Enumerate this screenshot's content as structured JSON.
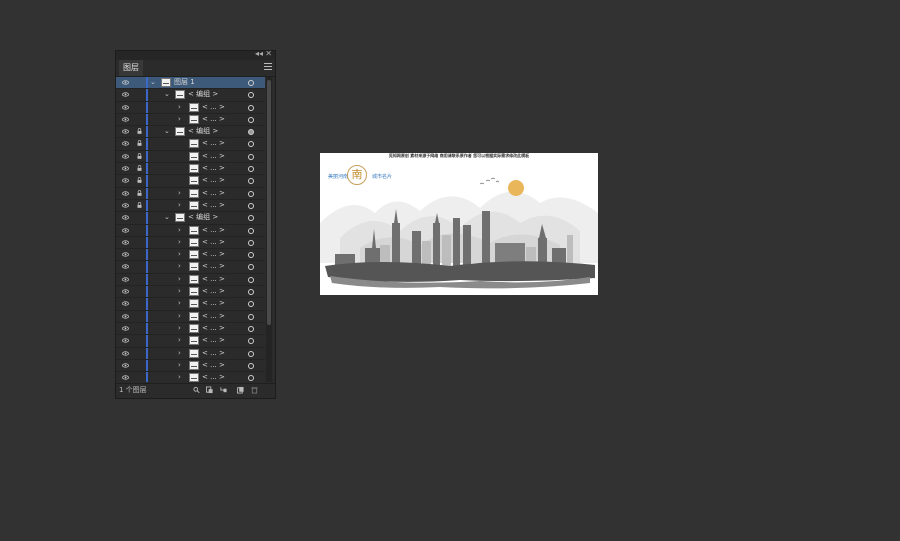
{
  "panel": {
    "tab_label": "图层",
    "collapse_glyph": "◂◂",
    "close_glyph": "✕",
    "layer_count": "1 个图层",
    "rows": [
      {
        "name": "图层 1",
        "indent": 0,
        "expanded": true,
        "locked": false,
        "selected": true,
        "target_filled": false
      },
      {
        "name": "< 编组 >",
        "indent": 1,
        "expanded": true,
        "locked": false,
        "selected": false,
        "target_filled": false
      },
      {
        "name": "< ... >",
        "indent": 2,
        "expanded": false,
        "locked": false,
        "selected": false,
        "target_filled": false
      },
      {
        "name": "< ... >",
        "indent": 2,
        "expanded": false,
        "locked": false,
        "selected": false,
        "target_filled": false
      },
      {
        "name": "< 编组 >",
        "indent": 1,
        "expanded": true,
        "locked": true,
        "selected": false,
        "target_filled": true
      },
      {
        "name": "< ... >",
        "indent": 2,
        "expanded": null,
        "locked": true,
        "selected": false,
        "target_filled": false
      },
      {
        "name": "< ... >",
        "indent": 2,
        "expanded": null,
        "locked": true,
        "selected": false,
        "target_filled": false
      },
      {
        "name": "< ... >",
        "indent": 2,
        "expanded": null,
        "locked": true,
        "selected": false,
        "target_filled": false
      },
      {
        "name": "< ... >",
        "indent": 2,
        "expanded": null,
        "locked": true,
        "selected": false,
        "target_filled": false
      },
      {
        "name": "< ... >",
        "indent": 2,
        "expanded": false,
        "locked": true,
        "selected": false,
        "target_filled": false
      },
      {
        "name": "< ... >",
        "indent": 2,
        "expanded": false,
        "locked": true,
        "selected": false,
        "target_filled": false
      },
      {
        "name": "< 编组 >",
        "indent": 1,
        "expanded": true,
        "locked": false,
        "selected": false,
        "target_filled": false
      },
      {
        "name": "< ... >",
        "indent": 2,
        "expanded": false,
        "locked": false,
        "selected": false,
        "target_filled": false
      },
      {
        "name": "< ... >",
        "indent": 2,
        "expanded": false,
        "locked": false,
        "selected": false,
        "target_filled": false
      },
      {
        "name": "< ... >",
        "indent": 2,
        "expanded": false,
        "locked": false,
        "selected": false,
        "target_filled": false
      },
      {
        "name": "< ... >",
        "indent": 2,
        "expanded": false,
        "locked": false,
        "selected": false,
        "target_filled": false
      },
      {
        "name": "< ... >",
        "indent": 2,
        "expanded": false,
        "locked": false,
        "selected": false,
        "target_filled": false
      },
      {
        "name": "< ... >",
        "indent": 2,
        "expanded": false,
        "locked": false,
        "selected": false,
        "target_filled": false
      },
      {
        "name": "< ... >",
        "indent": 2,
        "expanded": false,
        "locked": false,
        "selected": false,
        "target_filled": false
      },
      {
        "name": "< ... >",
        "indent": 2,
        "expanded": false,
        "locked": false,
        "selected": false,
        "target_filled": false
      },
      {
        "name": "< ... >",
        "indent": 2,
        "expanded": false,
        "locked": false,
        "selected": false,
        "target_filled": false
      },
      {
        "name": "< ... >",
        "indent": 2,
        "expanded": false,
        "locked": false,
        "selected": false,
        "target_filled": false
      },
      {
        "name": "< ... >",
        "indent": 2,
        "expanded": false,
        "locked": false,
        "selected": false,
        "target_filled": false
      },
      {
        "name": "< ... >",
        "indent": 2,
        "expanded": false,
        "locked": false,
        "selected": false,
        "target_filled": false
      },
      {
        "name": "< ... >",
        "indent": 2,
        "expanded": false,
        "locked": false,
        "selected": false,
        "target_filled": false
      }
    ],
    "footer_icons": [
      "search-layer-icon",
      "make-clipping-mask-icon",
      "create-sublayer-icon",
      "create-new-layer-icon",
      "delete-icon"
    ]
  },
  "artboard": {
    "caption": "觅知网原创 素材来源于网络 商用请联系原作者 您可以根据实际需求修改此模板",
    "logo_left": "美丽河南",
    "logo_char": "南",
    "logo_right": "城市名片"
  },
  "colors": {
    "workspace": "#323232",
    "panel": "#2b2b2b",
    "selection": "#3d5a7a",
    "layer_color_bar": "#3c69c9",
    "accent_sun": "#e9b65a"
  }
}
